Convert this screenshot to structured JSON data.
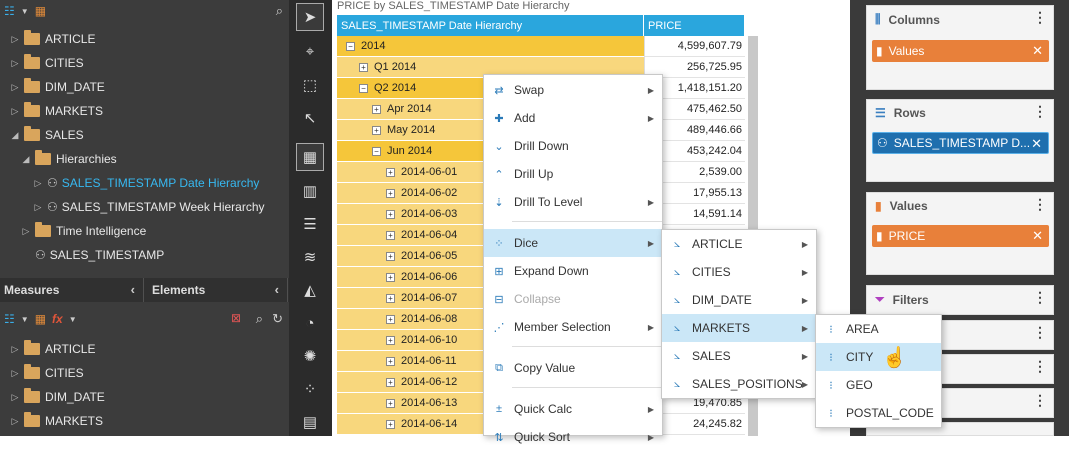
{
  "left": {
    "tree": [
      {
        "label": "ARTICLE"
      },
      {
        "label": "CITIES"
      },
      {
        "label": "DIM_DATE"
      },
      {
        "label": "MARKETS"
      },
      {
        "label": "SALES"
      },
      {
        "label": "Hierarchies"
      },
      {
        "label": "SALES_TIMESTAMP Date Hierarchy"
      },
      {
        "label": "SALES_TIMESTAMP Week Hierarchy"
      },
      {
        "label": "Time Intelligence"
      },
      {
        "label": "SALES_TIMESTAMP"
      }
    ],
    "tab_measures": "Measures",
    "tab_elements": "Elements",
    "tree2": [
      {
        "label": "ARTICLE"
      },
      {
        "label": "CITIES"
      },
      {
        "label": "DIM_DATE"
      },
      {
        "label": "MARKETS"
      }
    ]
  },
  "grid": {
    "title": "PRICE by SALES_TIMESTAMP Date Hierarchy",
    "col1": "SALES_TIMESTAMP Date Hierarchy",
    "col2": "PRICE",
    "rows": [
      {
        "label": "2014",
        "value": "4,599,607.79",
        "sign": "−"
      },
      {
        "label": "Q1 2014",
        "value": "256,725.95",
        "sign": "+"
      },
      {
        "label": "Q2 2014",
        "value": "1,418,151.20",
        "sign": "−"
      },
      {
        "label": "Apr 2014",
        "value": "475,462.50",
        "sign": "+"
      },
      {
        "label": "May 2014",
        "value": "489,446.66",
        "sign": "+"
      },
      {
        "label": "Jun 2014",
        "value": "453,242.04",
        "sign": "−"
      },
      {
        "label": "2014-06-01",
        "value": "2,539.00",
        "sign": "+"
      },
      {
        "label": "2014-06-02",
        "value": "17,955.13",
        "sign": "+"
      },
      {
        "label": "2014-06-03",
        "value": "14,591.14",
        "sign": "+"
      },
      {
        "label": "2014-06-04",
        "value": "",
        "sign": "+"
      },
      {
        "label": "2014-06-05",
        "value": "",
        "sign": "+"
      },
      {
        "label": "2014-06-06",
        "value": "",
        "sign": "+"
      },
      {
        "label": "2014-06-07",
        "value": "",
        "sign": "+"
      },
      {
        "label": "2014-06-08",
        "value": "",
        "sign": "+"
      },
      {
        "label": "2014-06-10",
        "value": "",
        "sign": "+"
      },
      {
        "label": "2014-06-11",
        "value": "",
        "sign": "+"
      },
      {
        "label": "2014-06-12",
        "value": "",
        "sign": "+"
      },
      {
        "label": "2014-06-13",
        "value": "19,470.85",
        "sign": "+"
      },
      {
        "label": "2014-06-14",
        "value": "24,245.82",
        "sign": "+"
      }
    ]
  },
  "context_menu": {
    "items": [
      {
        "label": "Swap",
        "icon": "swap-icon",
        "arrow": true
      },
      {
        "label": "Add",
        "icon": "add-icon",
        "arrow": true
      },
      {
        "label": "Drill Down",
        "icon": "drill-down-icon",
        "arrow": false
      },
      {
        "label": "Drill Up",
        "icon": "drill-up-icon",
        "arrow": false
      },
      {
        "label": "Drill To Level",
        "icon": "drill-level-icon",
        "arrow": true
      },
      {
        "label": "Dice",
        "icon": "dice-icon",
        "arrow": true
      },
      {
        "label": "Expand Down",
        "icon": "expand-icon",
        "arrow": false
      },
      {
        "label": "Collapse",
        "icon": "collapse-icon",
        "arrow": false
      },
      {
        "label": "Member Selection",
        "icon": "member-selection-icon",
        "arrow": true
      },
      {
        "label": "Copy Value",
        "icon": "copy-icon",
        "arrow": false
      },
      {
        "label": "Quick Calc",
        "icon": "quick-calc-icon",
        "arrow": true
      },
      {
        "label": "Quick Sort",
        "icon": "quick-sort-icon",
        "arrow": true
      }
    ]
  },
  "dice_submenu": {
    "items": [
      "ARTICLE",
      "CITIES",
      "DIM_DATE",
      "MARKETS",
      "SALES",
      "SALES_POSITIONS"
    ]
  },
  "markets_submenu": {
    "items": [
      "AREA",
      "CITY",
      "GEO",
      "POSTAL_CODE"
    ]
  },
  "right": {
    "columns_title": "Columns",
    "columns_pill": "Values",
    "rows_title": "Rows",
    "rows_pill": "SALES_TIMESTAMP D...",
    "values_title": "Values",
    "values_pill": "PRICE",
    "filters_title": "Filters"
  },
  "colors": {
    "accent_blue": "#2aa6dd",
    "highlight_row": "#f5c63a",
    "pill_orange": "#e8803a",
    "pill_blue": "#1f6fae"
  }
}
